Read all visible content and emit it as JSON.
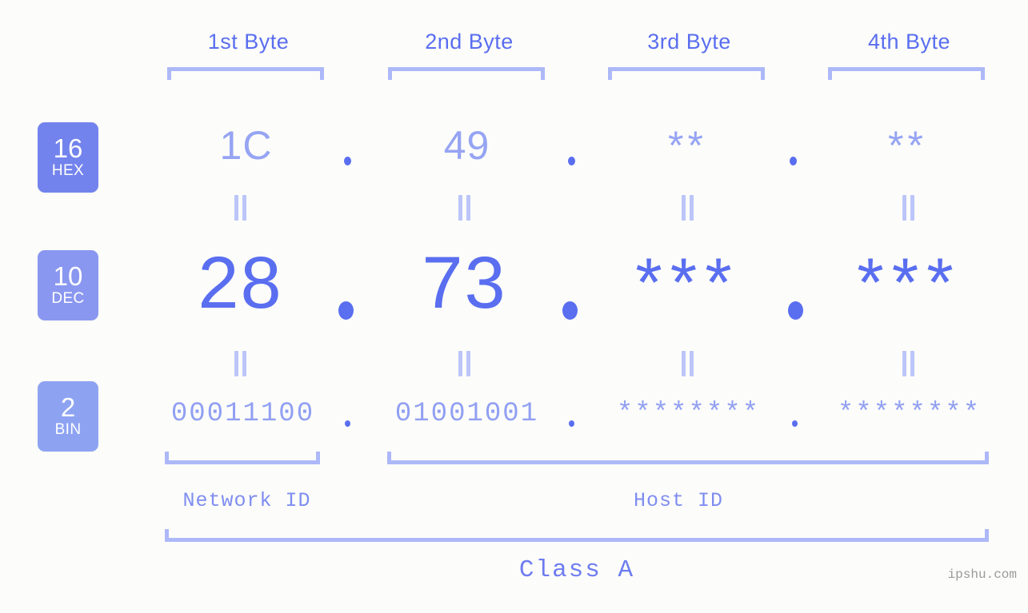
{
  "theme": {
    "background": "#fcfdfa",
    "accent_strong": "#5a6ef0",
    "accent_mid": "#8a97f0",
    "accent_light": "#adb8f9",
    "bracket": "#adb8f9",
    "badge_hex_bg": "#7383ed",
    "badge_dec_bg": "#8a97f0",
    "badge_bin_bg": "#8da3f2"
  },
  "byte_headers": [
    {
      "label": "1st Byte"
    },
    {
      "label": "2nd Byte"
    },
    {
      "label": "3rd Byte"
    },
    {
      "label": "4th Byte"
    }
  ],
  "bases": [
    {
      "id": "hex",
      "number": "16",
      "name": "HEX"
    },
    {
      "id": "dec",
      "number": "10",
      "name": "DEC"
    },
    {
      "id": "bin",
      "number": "2",
      "name": "BIN"
    }
  ],
  "rows": {
    "hex": {
      "base_number": "16",
      "base_name": "HEX",
      "values": [
        "1C",
        "49",
        "**",
        "**"
      ],
      "separator": "."
    },
    "dec": {
      "base_number": "10",
      "base_name": "DEC",
      "values": [
        "28",
        "73",
        "***",
        "***"
      ],
      "separator": "."
    },
    "bin": {
      "base_number": "2",
      "base_name": "BIN",
      "values": [
        "00011100",
        "01001001",
        "********",
        "********"
      ],
      "separator": "."
    }
  },
  "equality_marks": {
    "hex_to_dec": [
      "||",
      "||",
      "||",
      "||"
    ],
    "dec_to_bin": [
      "||",
      "||",
      "||",
      "||"
    ]
  },
  "segments": [
    {
      "label": "Network ID"
    },
    {
      "label": "Host ID"
    }
  ],
  "class": {
    "label": "Class A"
  },
  "watermark": {
    "text": "ipshu.com"
  }
}
